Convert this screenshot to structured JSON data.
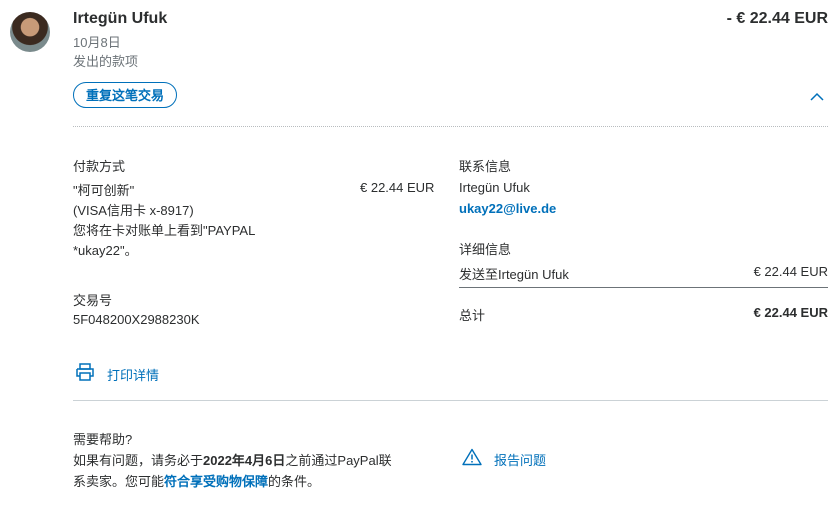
{
  "transaction": {
    "name": "Irtegün Ufuk",
    "date": "10月8日",
    "subtitle": "发出的款项",
    "amount": "- € 22.44 EUR",
    "repeat_label": "重复这笔交易"
  },
  "payment_method": {
    "title": "付款方式",
    "name": "\"柯可创新\"",
    "card": "(VISA信用卡 x-8917)",
    "note_line1": "您将在卡对账单上看到\"PAYPAL",
    "note_line2": "*ukay22\"。",
    "amount": "€ 22.44 EUR"
  },
  "transaction_id": {
    "title": "交易号",
    "value": "5F048200X2988230K"
  },
  "contact": {
    "title": "联系信息",
    "name": "Irtegün Ufuk",
    "email": "ukay22@live.de"
  },
  "details": {
    "title": "详细信息",
    "sent_to_label": "发送至Irtegün Ufuk",
    "sent_to_amount": "€ 22.44 EUR",
    "total_label": "总计",
    "total_amount": "€ 22.44 EUR"
  },
  "print": {
    "label": "打印详情"
  },
  "help": {
    "title": "需要帮助?",
    "text_part1": "如果有问题，请务必于",
    "deadline": "2022年4月6日",
    "text_part2": "之前通过PayPal联系卖家。您可能",
    "link_label": "符合享受购物保障",
    "text_part3": "的条件。"
  },
  "report": {
    "label": "报告问题"
  },
  "colors": {
    "accent": "#0070ba",
    "text": "#2c2e2f",
    "muted": "#6c7378"
  }
}
